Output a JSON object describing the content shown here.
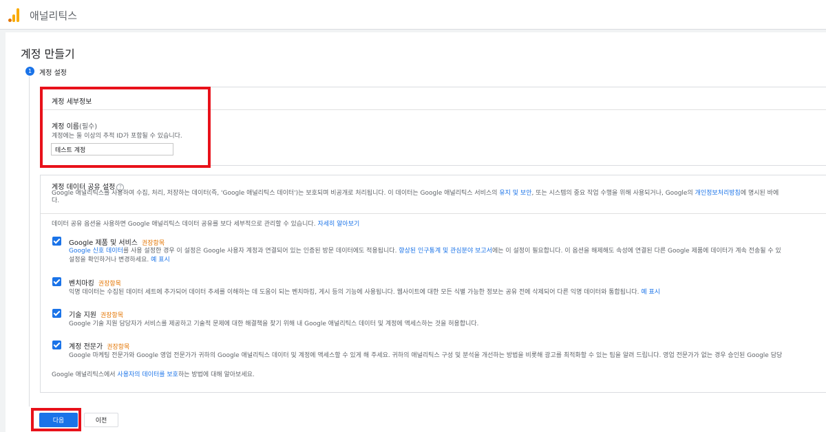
{
  "app": {
    "title": "애널리틱스"
  },
  "page": {
    "title": "계정 만들기"
  },
  "step": {
    "number": "1",
    "label": "계정 설정"
  },
  "account_details": {
    "title": "계정 세부정보",
    "name_label": "계정 이름",
    "required": "(필수)",
    "help": "계정에는 둘 이상의 추적 ID가 포함될 수 있습니다.",
    "value": "테스트 계정"
  },
  "sharing": {
    "title": "계정 데이터 공유 설정",
    "help_icon": "?",
    "desc_part1": "Google 애널리틱스를 사용하여 수집, 처리, 저장하는 데이터(즉, 'Google 애널리틱스 데이터')는 보호되며 비공개로 처리됩니다. 이 데이터는 Google 애널리틱스 서비스의 ",
    "desc_link1": "유지 및 보안",
    "desc_part2": ", 또는 시스템의 중요 작업 수행을 위해 사용되거나, Google의 ",
    "desc_link2": "개인정보처리방침",
    "desc_part3": "에 명시된 바에",
    "desc_line2": "다.",
    "intro": "데이터 공유 옵션을 사용하면 Google 애널리틱스 데이터 공유를 보다 세부적으로 관리할 수 있습니다.",
    "intro_link": "자세히 알아보기",
    "options": [
      {
        "title": "Google 제품 및 서비스",
        "rec": "권장항목",
        "desc_link1": "Google 신호 데이터",
        "desc_part1": "를 사용 설정한 경우 이 설정은 Google 사용자 계정과 연결되어 있는 인증된 방문 데이터에도 적용됩니다. ",
        "desc_link2": "향상된 인구통계 및 관심분야 보고서",
        "desc_part2": "에는 이 설정이 필요합니다. 이 옵션을 해제해도 속성에 연결된 다른 Google 제품에 데이터가 계속 전송될 수 있",
        "desc_line2": "설정을 확인하거나 변경하세요.",
        "desc_line2_link": "예 표시"
      },
      {
        "title": "벤치마킹",
        "rec": "권장항목",
        "desc": "익명 데이터는 수집된 데이터 세트에 추가되어 데이터 추세를 이해하는 데 도움이 되는 벤치마킹, 게시 등의 기능에 사용됩니다. 웹사이트에 대한 모든 식별 가능한 정보는 공유 전에 삭제되어 다른 익명 데이터와 통합됩니다.",
        "link": "예 표시"
      },
      {
        "title": "기술 지원",
        "rec": "권장항목",
        "desc": "Google 기술 지원 담당자가 서비스를 제공하고 기술적 문제에 대한 해결책을 찾기 위해 내 Google 애널리틱스 데이터 및 계정에 액세스하는 것을 허용합니다."
      },
      {
        "title": "계정 전문가",
        "rec": "권장항목",
        "desc": "Google 마케팅 전문가와 Google 영업 전문가가 귀하의 Google 애널리틱스 데이터 및 계정에 액세스할 수 있게 해 주세요. 귀하의 애널리틱스 구성 및 분석을 개선하는 방법을 비롯해 광고를 최적화할 수 있는 팁을 알려 드립니다. 영업 전문가가 없는 경우 승인된 Google 담당"
      }
    ],
    "footer_part1": "Google 애널리틱스에서 ",
    "footer_link": "사용자의 데이터를 보호",
    "footer_part2": "하는 방법에 대해 알아보세요."
  },
  "buttons": {
    "next": "다음",
    "prev": "이전"
  },
  "colors": {
    "accent": "#1a73e8",
    "recommended": "#e37400",
    "highlight": "#e8111a"
  }
}
